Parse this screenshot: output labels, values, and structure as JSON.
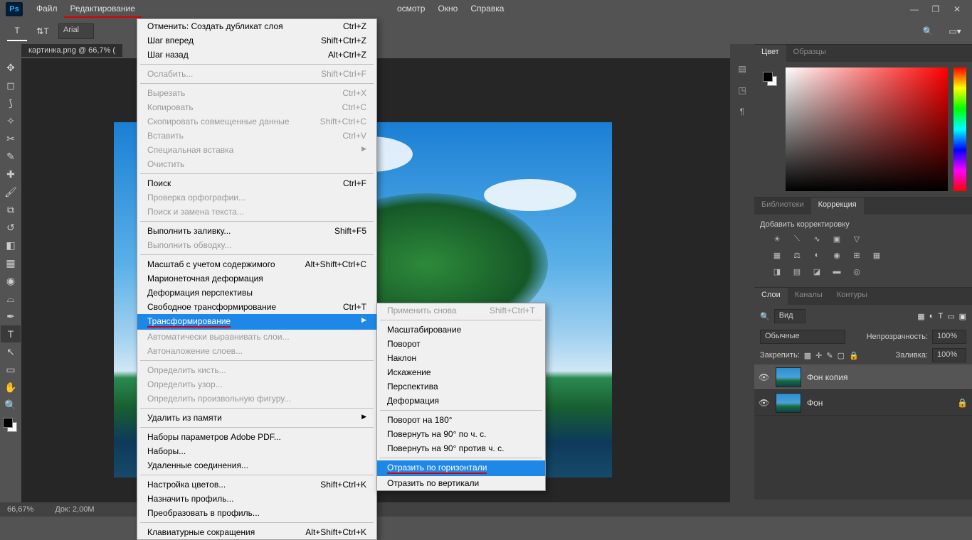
{
  "menubar": {
    "items": [
      "Файл",
      "Редактирование",
      "",
      "",
      "",
      "",
      "",
      "",
      "",
      "осмотр",
      "Окно",
      "Справка"
    ],
    "underlined_index": 1
  },
  "toolbar": {
    "font": "Arial"
  },
  "document": {
    "tab": "картинка.png @ 66,7% (",
    "zoom": "66,67%",
    "docinfo": "Док: 2,00M"
  },
  "edit_menu": [
    {
      "label": "Отменить: Создать дубликат слоя",
      "shortcut": "Ctrl+Z"
    },
    {
      "label": "Шаг вперед",
      "shortcut": "Shift+Ctrl+Z"
    },
    {
      "label": "Шаг назад",
      "shortcut": "Alt+Ctrl+Z"
    },
    {
      "sep": true
    },
    {
      "label": "Ослабить...",
      "shortcut": "Shift+Ctrl+F",
      "disabled": true
    },
    {
      "sep": true
    },
    {
      "label": "Вырезать",
      "shortcut": "Ctrl+X",
      "disabled": true
    },
    {
      "label": "Копировать",
      "shortcut": "Ctrl+C",
      "disabled": true
    },
    {
      "label": "Скопировать совмещенные данные",
      "shortcut": "Shift+Ctrl+C",
      "disabled": true
    },
    {
      "label": "Вставить",
      "shortcut": "Ctrl+V",
      "disabled": true
    },
    {
      "label": "Специальная вставка",
      "hasub": true,
      "disabled": true
    },
    {
      "label": "Очистить",
      "disabled": true
    },
    {
      "sep": true
    },
    {
      "label": "Поиск",
      "shortcut": "Ctrl+F"
    },
    {
      "label": "Проверка орфографии...",
      "disabled": true
    },
    {
      "label": "Поиск и замена текста...",
      "disabled": true
    },
    {
      "sep": true
    },
    {
      "label": "Выполнить заливку...",
      "shortcut": "Shift+F5"
    },
    {
      "label": "Выполнить обводку...",
      "disabled": true
    },
    {
      "sep": true
    },
    {
      "label": "Масштаб с учетом содержимого",
      "shortcut": "Alt+Shift+Ctrl+C"
    },
    {
      "label": "Марионеточная деформация"
    },
    {
      "label": "Деформация перспективы"
    },
    {
      "label": "Свободное трансформирование",
      "shortcut": "Ctrl+T"
    },
    {
      "label": "Трансформирование",
      "hasub": true,
      "highlight": true,
      "underlined": true
    },
    {
      "label": "Автоматически выравнивать слои...",
      "disabled": true
    },
    {
      "label": "Автоналожение слоев...",
      "disabled": true
    },
    {
      "sep": true
    },
    {
      "label": "Определить кисть...",
      "disabled": true
    },
    {
      "label": "Определить узор...",
      "disabled": true
    },
    {
      "label": "Определить произвольную фигуру...",
      "disabled": true
    },
    {
      "sep": true
    },
    {
      "label": "Удалить из памяти",
      "hasub": true
    },
    {
      "sep": true
    },
    {
      "label": "Наборы параметров Adobe PDF..."
    },
    {
      "label": "Наборы..."
    },
    {
      "label": "Удаленные соединения..."
    },
    {
      "sep": true
    },
    {
      "label": "Настройка цветов...",
      "shortcut": "Shift+Ctrl+K"
    },
    {
      "label": "Назначить профиль..."
    },
    {
      "label": "Преобразовать в профиль..."
    },
    {
      "sep": true
    },
    {
      "label": "Клавиатурные сокращения",
      "shortcut": "Alt+Shift+Ctrl+K",
      "cut": true
    }
  ],
  "transform_submenu": [
    {
      "label": "Применить снова",
      "shortcut": "Shift+Ctrl+T",
      "disabled": true
    },
    {
      "sep": true
    },
    {
      "label": "Масштабирование"
    },
    {
      "label": "Поворот"
    },
    {
      "label": "Наклон"
    },
    {
      "label": "Искажение"
    },
    {
      "label": "Перспектива"
    },
    {
      "label": "Деформация"
    },
    {
      "sep": true
    },
    {
      "label": "Поворот на 180°"
    },
    {
      "label": "Повернуть на 90° по ч. с."
    },
    {
      "label": "Повернуть на 90° против ч. с."
    },
    {
      "sep": true
    },
    {
      "label": "Отразить по горизонтали",
      "highlight": true,
      "underlined": true
    },
    {
      "label": "Отразить по вертикали"
    }
  ],
  "panels": {
    "color": {
      "tabs": [
        "Цвет",
        "Образцы"
      ],
      "active": 0
    },
    "lib": {
      "tabs": [
        "Библиотеки",
        "Коррекция"
      ],
      "active": 1,
      "title": "Добавить корректировку"
    },
    "layers": {
      "tabs": [
        "Слои",
        "Каналы",
        "Контуры"
      ],
      "active": 0,
      "kind": "Вид",
      "blend": "Обычные",
      "opacity_label": "Непрозрачность:",
      "opacity": "100%",
      "lock_label": "Закрепить:",
      "fill_label": "Заливка:",
      "fill": "100%",
      "items": [
        {
          "name": "Фон копия",
          "sel": true
        },
        {
          "name": "Фон",
          "locked": true
        }
      ]
    }
  }
}
